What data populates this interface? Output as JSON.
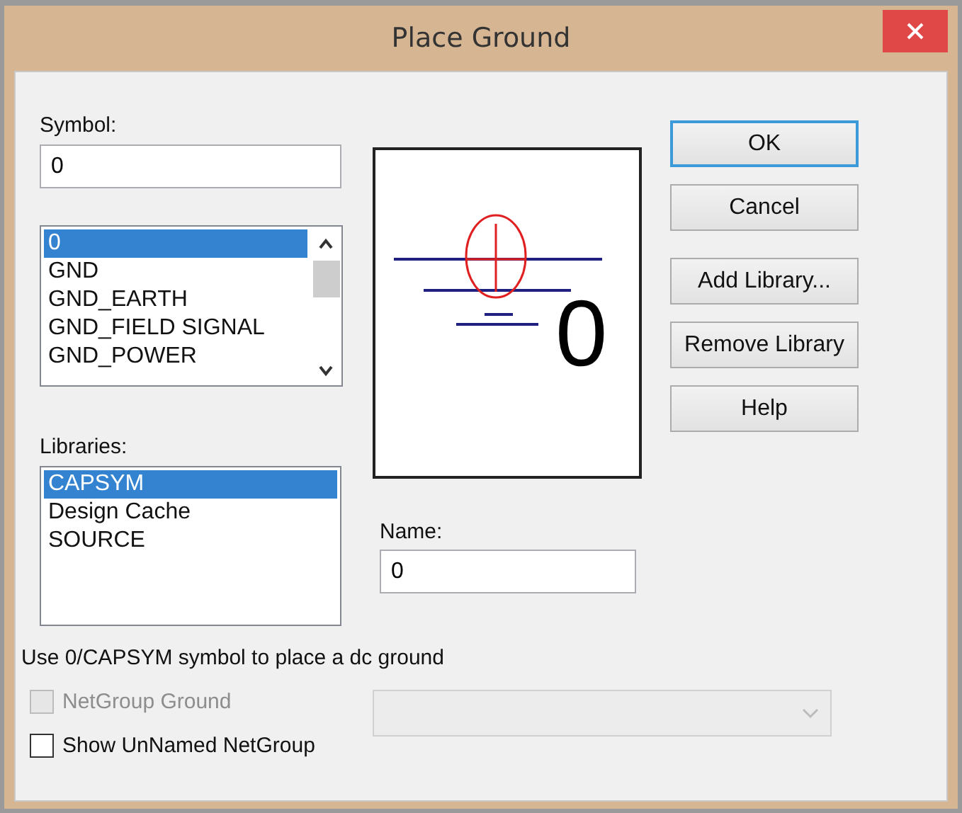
{
  "window": {
    "title": "Place Ground"
  },
  "symbol": {
    "label": "Symbol:",
    "value": "0"
  },
  "symbol_list": {
    "items": [
      {
        "label": "0",
        "selected": true
      },
      {
        "label": "GND",
        "selected": false
      },
      {
        "label": "GND_EARTH",
        "selected": false
      },
      {
        "label": "GND_FIELD SIGNAL",
        "selected": false
      },
      {
        "label": "GND_POWER",
        "selected": false
      }
    ]
  },
  "libraries": {
    "label": "Libraries:",
    "items": [
      {
        "label": "CAPSYM",
        "selected": true
      },
      {
        "label": "Design Cache",
        "selected": false
      },
      {
        "label": "SOURCE",
        "selected": false
      }
    ]
  },
  "preview": {
    "symbol_name": "0"
  },
  "name": {
    "label": "Name:",
    "value": "0"
  },
  "buttons": [
    {
      "label": "OK",
      "default": true
    },
    {
      "label": "Cancel",
      "default": false
    },
    {
      "label": "Add Library...",
      "default": false
    },
    {
      "label": "Remove Library",
      "default": false
    },
    {
      "label": "Help",
      "default": false
    }
  ],
  "hint": "Use 0/CAPSYM symbol to place a dc ground",
  "checkboxes": [
    {
      "label": "NetGroup Ground",
      "checked": false,
      "disabled": true
    },
    {
      "label": "Show UnNamed NetGroup",
      "checked": false,
      "disabled": false
    }
  ],
  "netgroup_dropdown": {
    "disabled": true
  }
}
